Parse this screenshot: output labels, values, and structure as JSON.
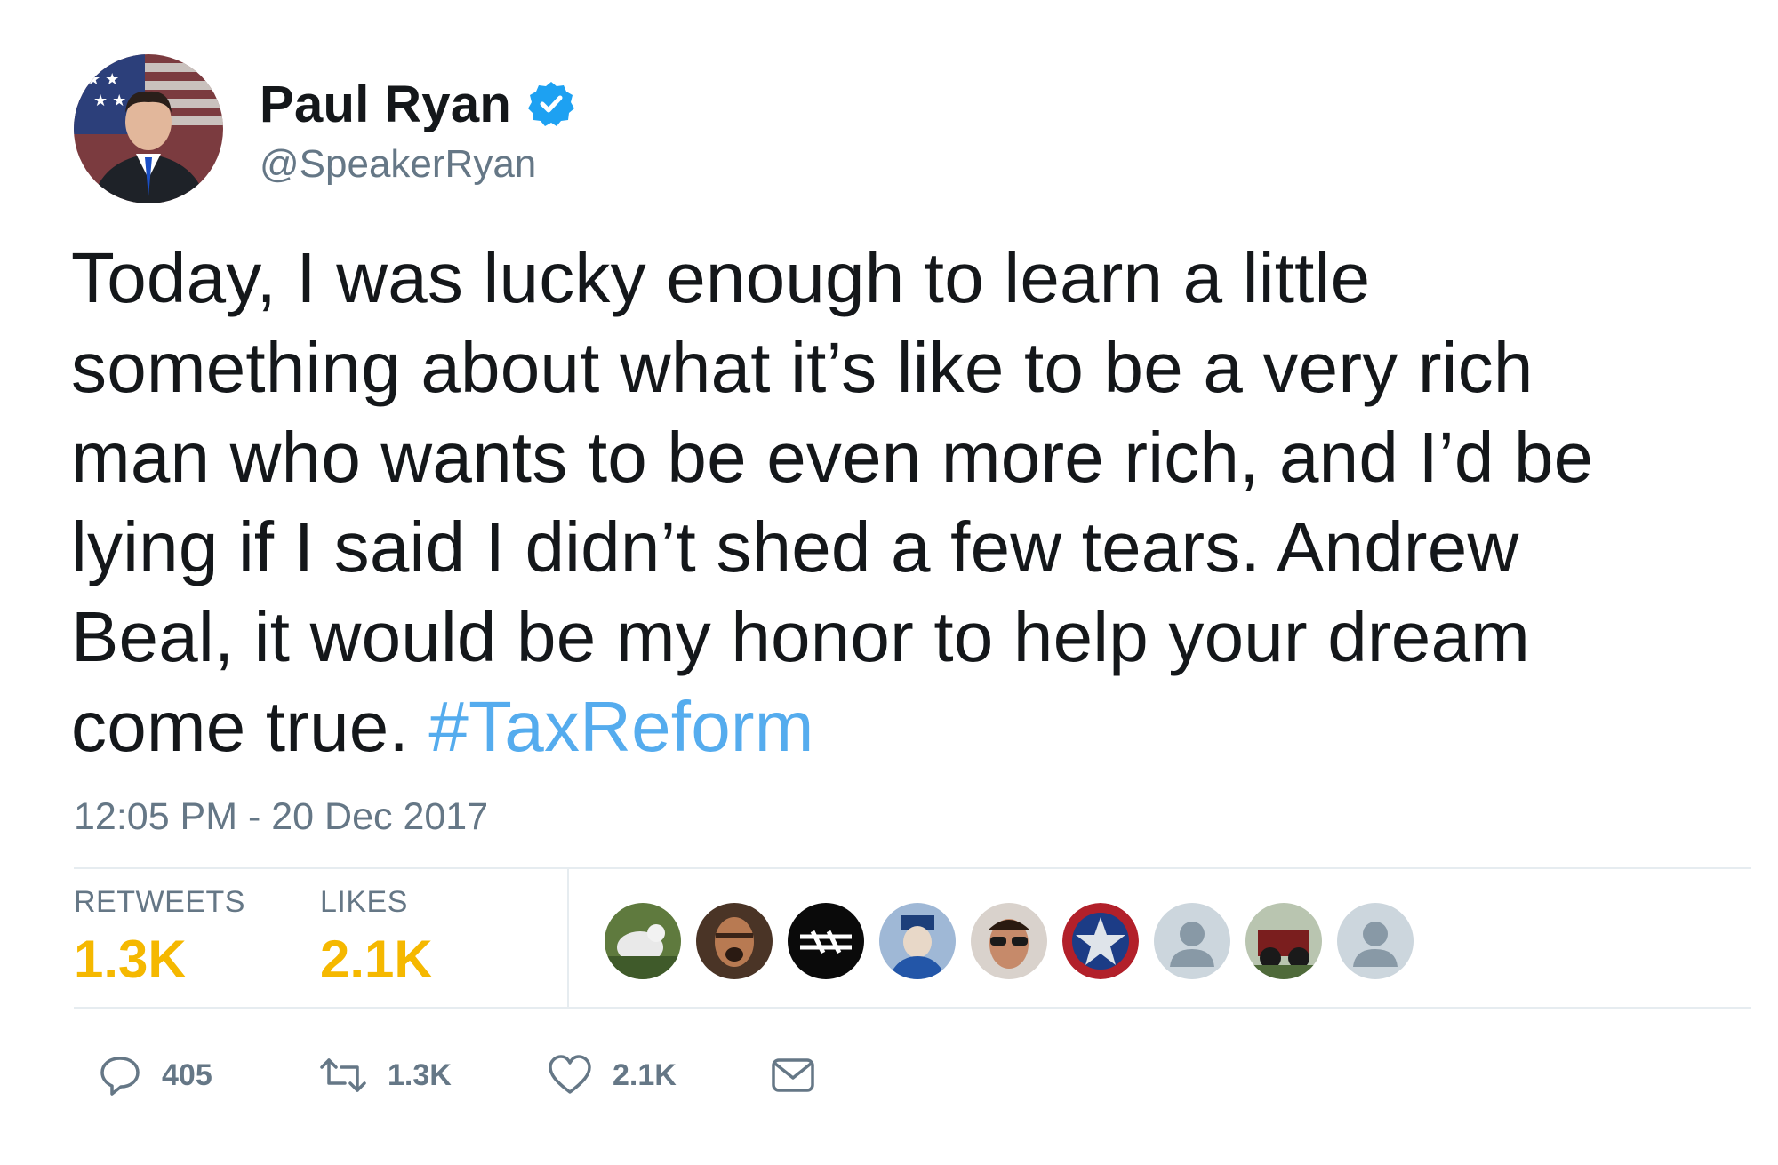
{
  "author": {
    "display_name": "Paul Ryan",
    "handle": "@SpeakerRyan",
    "verified": true
  },
  "tweet": {
    "text_lines": [
      "Today, I was lucky enough to learn a little",
      "something about what it’s like to be a very rich",
      "man who wants to be even more rich, and I’d be",
      "lying if I said I didn’t shed a few tears. Andrew",
      "Beal, it would be my honor to help your dream",
      "come true. "
    ],
    "hashtag": "#TaxReform",
    "timestamp": "12:05 PM - 20 Dec 2017"
  },
  "stats": {
    "retweets_label": "RETWEETS",
    "retweets_value": "1.3K",
    "likes_label": "LIKES",
    "likes_value": "2.1K"
  },
  "likers": [
    {
      "icon": "liker-avatar-photo"
    },
    {
      "icon": "liker-avatar-photo"
    },
    {
      "icon": "liker-avatar-logo"
    },
    {
      "icon": "liker-avatar-photo"
    },
    {
      "icon": "liker-avatar-photo"
    },
    {
      "icon": "liker-avatar-star"
    },
    {
      "icon": "default-avatar-icon"
    },
    {
      "icon": "liker-avatar-photo"
    },
    {
      "icon": "default-avatar-icon"
    }
  ],
  "actions": {
    "reply_count": "405",
    "retweet_count": "1.3K",
    "like_count": "2.1K"
  },
  "colors": {
    "text": "#14171a",
    "secondary": "#657786",
    "hashtag": "#55acee",
    "stat_value": "#f5b800",
    "verified": "#1da1f2",
    "divider": "#e6ecf0"
  }
}
